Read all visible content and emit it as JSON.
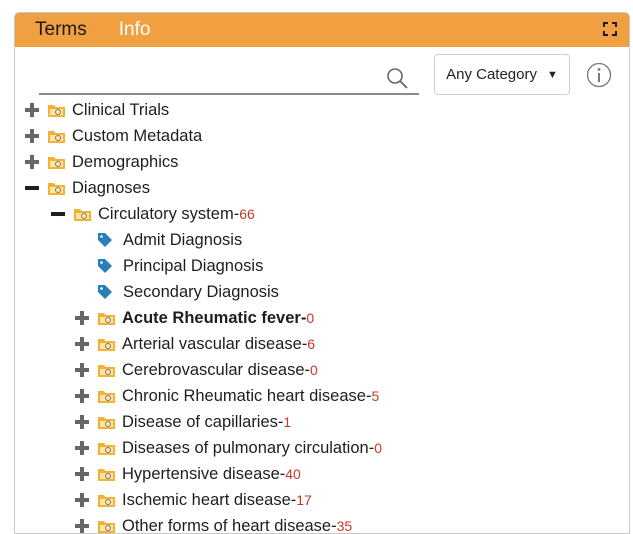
{
  "tabs": {
    "terms": "Terms",
    "info": "Info"
  },
  "search": {
    "placeholder": "",
    "value": ""
  },
  "category_select": {
    "value": "Any Category"
  },
  "tree": {
    "separator": " - ",
    "top_items": [
      {
        "label": "Clinical Trials"
      },
      {
        "label": "Custom Metadata"
      },
      {
        "label": "Demographics"
      },
      {
        "label": "Diagnoses"
      }
    ],
    "circulatory": {
      "label": "Circulatory system",
      "count": "66"
    },
    "leaf_terms": [
      {
        "label": "Admit Diagnosis"
      },
      {
        "label": "Principal Diagnosis"
      },
      {
        "label": "Secondary Diagnosis"
      }
    ],
    "sub_folders": [
      {
        "label": "Acute Rheumatic fever",
        "count": "0"
      },
      {
        "label": "Arterial vascular disease",
        "count": "6"
      },
      {
        "label": "Cerebrovascular disease",
        "count": "0"
      },
      {
        "label": "Chronic Rheumatic heart disease",
        "count": "5"
      },
      {
        "label": "Disease of capillaries",
        "count": "1"
      },
      {
        "label": "Diseases of pulmonary circulation",
        "count": "0"
      },
      {
        "label": "Hypertensive disease",
        "count": "40"
      },
      {
        "label": "Ischemic heart disease",
        "count": "17"
      },
      {
        "label": "Other forms of heart disease",
        "count": "35"
      }
    ]
  },
  "colors": {
    "header": "#f0a040",
    "count": "#c0392b",
    "tag": "#2a7fb8",
    "folder": "#f2b233"
  }
}
